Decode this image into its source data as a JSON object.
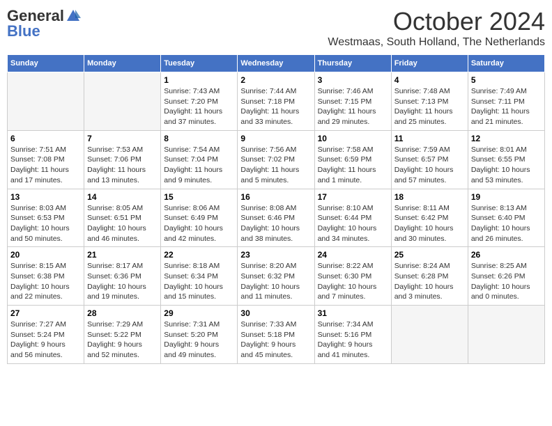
{
  "header": {
    "logo_general": "General",
    "logo_blue": "Blue",
    "month": "October 2024",
    "location": "Westmaas, South Holland, The Netherlands"
  },
  "weekdays": [
    "Sunday",
    "Monday",
    "Tuesday",
    "Wednesday",
    "Thursday",
    "Friday",
    "Saturday"
  ],
  "weeks": [
    [
      {
        "day": "",
        "info": ""
      },
      {
        "day": "",
        "info": ""
      },
      {
        "day": "1",
        "info": "Sunrise: 7:43 AM\nSunset: 7:20 PM\nDaylight: 11 hours\nand 37 minutes."
      },
      {
        "day": "2",
        "info": "Sunrise: 7:44 AM\nSunset: 7:18 PM\nDaylight: 11 hours\nand 33 minutes."
      },
      {
        "day": "3",
        "info": "Sunrise: 7:46 AM\nSunset: 7:15 PM\nDaylight: 11 hours\nand 29 minutes."
      },
      {
        "day": "4",
        "info": "Sunrise: 7:48 AM\nSunset: 7:13 PM\nDaylight: 11 hours\nand 25 minutes."
      },
      {
        "day": "5",
        "info": "Sunrise: 7:49 AM\nSunset: 7:11 PM\nDaylight: 11 hours\nand 21 minutes."
      }
    ],
    [
      {
        "day": "6",
        "info": "Sunrise: 7:51 AM\nSunset: 7:08 PM\nDaylight: 11 hours\nand 17 minutes."
      },
      {
        "day": "7",
        "info": "Sunrise: 7:53 AM\nSunset: 7:06 PM\nDaylight: 11 hours\nand 13 minutes."
      },
      {
        "day": "8",
        "info": "Sunrise: 7:54 AM\nSunset: 7:04 PM\nDaylight: 11 hours\nand 9 minutes."
      },
      {
        "day": "9",
        "info": "Sunrise: 7:56 AM\nSunset: 7:02 PM\nDaylight: 11 hours\nand 5 minutes."
      },
      {
        "day": "10",
        "info": "Sunrise: 7:58 AM\nSunset: 6:59 PM\nDaylight: 11 hours\nand 1 minute."
      },
      {
        "day": "11",
        "info": "Sunrise: 7:59 AM\nSunset: 6:57 PM\nDaylight: 10 hours\nand 57 minutes."
      },
      {
        "day": "12",
        "info": "Sunrise: 8:01 AM\nSunset: 6:55 PM\nDaylight: 10 hours\nand 53 minutes."
      }
    ],
    [
      {
        "day": "13",
        "info": "Sunrise: 8:03 AM\nSunset: 6:53 PM\nDaylight: 10 hours\nand 50 minutes."
      },
      {
        "day": "14",
        "info": "Sunrise: 8:05 AM\nSunset: 6:51 PM\nDaylight: 10 hours\nand 46 minutes."
      },
      {
        "day": "15",
        "info": "Sunrise: 8:06 AM\nSunset: 6:49 PM\nDaylight: 10 hours\nand 42 minutes."
      },
      {
        "day": "16",
        "info": "Sunrise: 8:08 AM\nSunset: 6:46 PM\nDaylight: 10 hours\nand 38 minutes."
      },
      {
        "day": "17",
        "info": "Sunrise: 8:10 AM\nSunset: 6:44 PM\nDaylight: 10 hours\nand 34 minutes."
      },
      {
        "day": "18",
        "info": "Sunrise: 8:11 AM\nSunset: 6:42 PM\nDaylight: 10 hours\nand 30 minutes."
      },
      {
        "day": "19",
        "info": "Sunrise: 8:13 AM\nSunset: 6:40 PM\nDaylight: 10 hours\nand 26 minutes."
      }
    ],
    [
      {
        "day": "20",
        "info": "Sunrise: 8:15 AM\nSunset: 6:38 PM\nDaylight: 10 hours\nand 22 minutes."
      },
      {
        "day": "21",
        "info": "Sunrise: 8:17 AM\nSunset: 6:36 PM\nDaylight: 10 hours\nand 19 minutes."
      },
      {
        "day": "22",
        "info": "Sunrise: 8:18 AM\nSunset: 6:34 PM\nDaylight: 10 hours\nand 15 minutes."
      },
      {
        "day": "23",
        "info": "Sunrise: 8:20 AM\nSunset: 6:32 PM\nDaylight: 10 hours\nand 11 minutes."
      },
      {
        "day": "24",
        "info": "Sunrise: 8:22 AM\nSunset: 6:30 PM\nDaylight: 10 hours\nand 7 minutes."
      },
      {
        "day": "25",
        "info": "Sunrise: 8:24 AM\nSunset: 6:28 PM\nDaylight: 10 hours\nand 3 minutes."
      },
      {
        "day": "26",
        "info": "Sunrise: 8:25 AM\nSunset: 6:26 PM\nDaylight: 10 hours\nand 0 minutes."
      }
    ],
    [
      {
        "day": "27",
        "info": "Sunrise: 7:27 AM\nSunset: 5:24 PM\nDaylight: 9 hours\nand 56 minutes."
      },
      {
        "day": "28",
        "info": "Sunrise: 7:29 AM\nSunset: 5:22 PM\nDaylight: 9 hours\nand 52 minutes."
      },
      {
        "day": "29",
        "info": "Sunrise: 7:31 AM\nSunset: 5:20 PM\nDaylight: 9 hours\nand 49 minutes."
      },
      {
        "day": "30",
        "info": "Sunrise: 7:33 AM\nSunset: 5:18 PM\nDaylight: 9 hours\nand 45 minutes."
      },
      {
        "day": "31",
        "info": "Sunrise: 7:34 AM\nSunset: 5:16 PM\nDaylight: 9 hours\nand 41 minutes."
      },
      {
        "day": "",
        "info": ""
      },
      {
        "day": "",
        "info": ""
      }
    ]
  ]
}
